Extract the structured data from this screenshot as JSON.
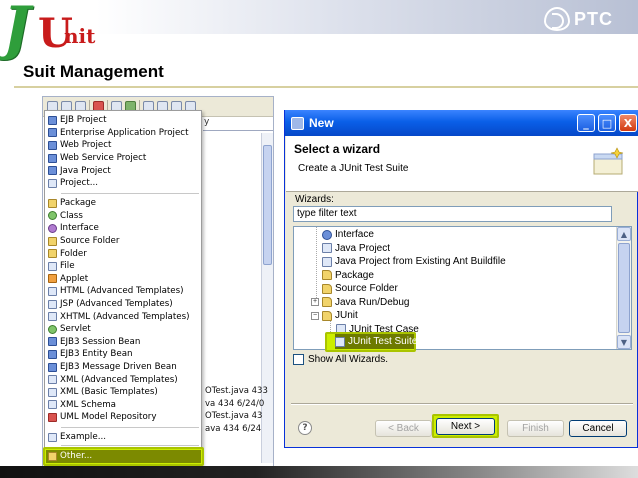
{
  "slide": {
    "title": "Suit Management",
    "logo_left": {
      "j": "J",
      "u": "U",
      "nit": "nit"
    },
    "logo_right": "PTC"
  },
  "eclipse": {
    "tab_fragment": "y",
    "file_lines": [
      "OTest.java 433",
      "va 434  6/24/0",
      "OTest.java 43",
      "ava 434  6/24"
    ]
  },
  "menu": {
    "items": [
      {
        "label": "EJB Project",
        "icon": "ejb-project-icon"
      },
      {
        "label": "Enterprise Application Project",
        "icon": "enterprise-app-icon"
      },
      {
        "label": "Web Project",
        "icon": "web-project-icon"
      },
      {
        "label": "Web Service Project",
        "icon": "web-service-icon"
      },
      {
        "label": "Java Project",
        "icon": "java-project-icon"
      },
      {
        "label": "Project...",
        "icon": "project-icon"
      },
      {
        "label": "Package",
        "icon": "package-icon"
      },
      {
        "label": "Class",
        "icon": "class-icon"
      },
      {
        "label": "Interface",
        "icon": "interface-icon"
      },
      {
        "label": "Source Folder",
        "icon": "source-folder-icon"
      },
      {
        "label": "Folder",
        "icon": "folder-icon"
      },
      {
        "label": "File",
        "icon": "file-icon"
      },
      {
        "label": "Applet",
        "icon": "applet-icon"
      },
      {
        "label": "HTML (Advanced Templates)",
        "icon": "html-icon"
      },
      {
        "label": "JSP (Advanced Templates)",
        "icon": "jsp-icon"
      },
      {
        "label": "XHTML (Advanced Templates)",
        "icon": "xhtml-icon"
      },
      {
        "label": "Servlet",
        "icon": "servlet-icon"
      },
      {
        "label": "EJB3 Session Bean",
        "icon": "session-bean-icon"
      },
      {
        "label": "EJB3 Entity Bean",
        "icon": "entity-bean-icon"
      },
      {
        "label": "EJB3 Message Driven Bean",
        "icon": "mdb-icon"
      },
      {
        "label": "XML (Advanced Templates)",
        "icon": "xml-icon"
      },
      {
        "label": "XML (Basic Templates)",
        "icon": "xml-basic-icon"
      },
      {
        "label": "XML Schema",
        "icon": "xml-schema-icon"
      },
      {
        "label": "UML Model Repository",
        "icon": "uml-icon"
      },
      {
        "label": "Example...",
        "icon": "example-icon"
      },
      {
        "label": "Other...",
        "icon": "other-icon"
      }
    ]
  },
  "dialog": {
    "title": "New",
    "banner_title": "Select a wizard",
    "banner_subtitle": "Create a JUnit Test Suite",
    "wizards_label": "Wizards:",
    "filter_value": "type filter text",
    "tree": [
      {
        "label": "Interface",
        "icon": "interface-icon"
      },
      {
        "label": "Java Project",
        "icon": "java-project-icon"
      },
      {
        "label": "Java Project from Existing Ant Buildfile",
        "icon": "ant-icon"
      },
      {
        "label": "Package",
        "icon": "package-icon"
      },
      {
        "label": "Source Folder",
        "icon": "source-folder-icon"
      },
      {
        "label": "Java Run/Debug",
        "icon": "folder-icon"
      },
      {
        "label": "JUnit",
        "icon": "folder-icon"
      },
      {
        "label": "JUnit Test Case",
        "icon": "junit-case-icon"
      },
      {
        "label": "JUnit Test Suite",
        "icon": "junit-suite-icon"
      }
    ],
    "show_all_label": "Show All Wizards.",
    "buttons": {
      "back": "< Back",
      "next": "Next >",
      "finish": "Finish",
      "cancel": "Cancel"
    },
    "window_buttons": {
      "minimize": "_",
      "maximize": "□",
      "close": "X"
    }
  },
  "colors": {
    "highlight": "#ccee00",
    "selection": "#6d7a00",
    "titlebar": "#0a5fe8"
  }
}
